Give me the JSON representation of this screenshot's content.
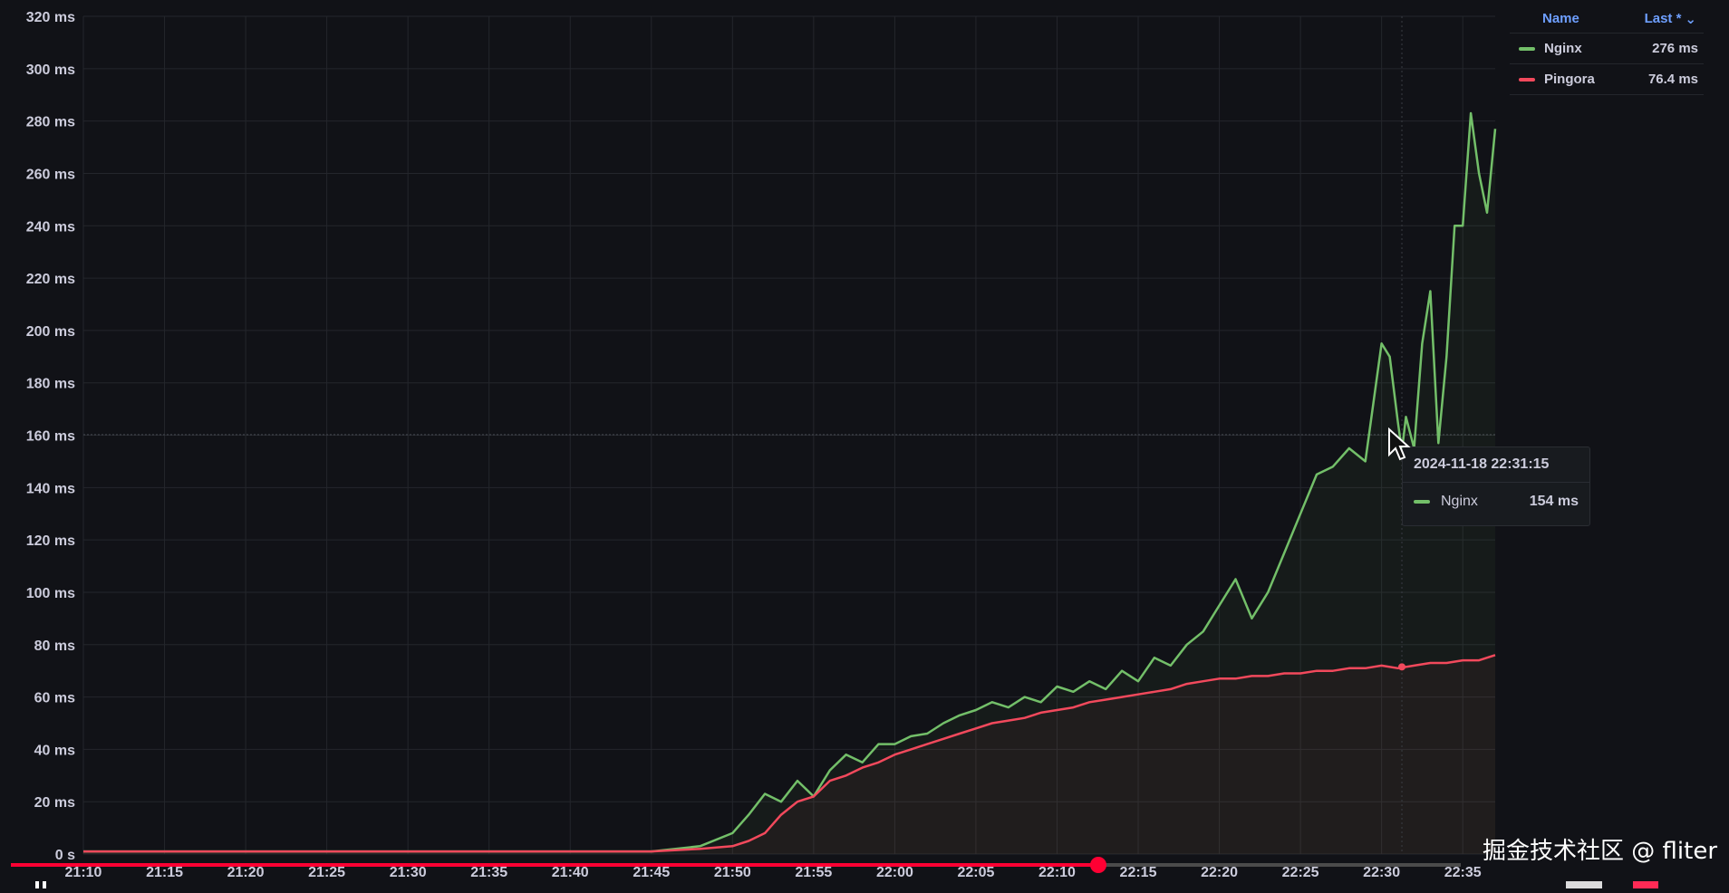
{
  "chart_data": {
    "type": "line",
    "y_ticks": [
      "0 s",
      "20 ms",
      "40 ms",
      "60 ms",
      "80 ms",
      "100 ms",
      "120 ms",
      "140 ms",
      "160 ms",
      "180 ms",
      "200 ms",
      "220 ms",
      "240 ms",
      "260 ms",
      "280 ms",
      "300 ms",
      "320 ms"
    ],
    "x_ticks": [
      "21:10",
      "21:15",
      "21:20",
      "21:25",
      "21:30",
      "21:35",
      "21:40",
      "21:45",
      "21:50",
      "21:55",
      "22:00",
      "22:05",
      "22:10",
      "22:15",
      "22:20",
      "22:25",
      "22:30",
      "22:35"
    ],
    "ylim": [
      0,
      320
    ],
    "x_range": [
      "21:10",
      "22:37"
    ],
    "grid": true,
    "series": [
      {
        "name": "Nginx",
        "color": "#73bf69",
        "x": [
          "21:10",
          "21:45",
          "21:48",
          "21:50",
          "21:51",
          "21:52",
          "21:53",
          "21:54",
          "21:55",
          "21:56",
          "21:57",
          "21:58",
          "21:59",
          "22:00",
          "22:01",
          "22:02",
          "22:03",
          "22:04",
          "22:05",
          "22:06",
          "22:07",
          "22:08",
          "22:09",
          "22:10",
          "22:11",
          "22:12",
          "22:13",
          "22:14",
          "22:15",
          "22:16",
          "22:17",
          "22:18",
          "22:19",
          "22:20",
          "22:21",
          "22:22",
          "22:23",
          "22:24",
          "22:25",
          "22:26",
          "22:27",
          "22:28",
          "22:29",
          "22:30",
          "22:30:30",
          "22:31",
          "22:31:15",
          "22:31:30",
          "22:32",
          "22:32:30",
          "22:33",
          "22:33:30",
          "22:34",
          "22:34:30",
          "22:35",
          "22:35:30",
          "22:36",
          "22:36:30",
          "22:37"
        ],
        "values": [
          1,
          1,
          3,
          8,
          15,
          23,
          20,
          28,
          22,
          32,
          38,
          35,
          42,
          42,
          45,
          46,
          50,
          53,
          55,
          58,
          56,
          60,
          58,
          64,
          62,
          66,
          63,
          70,
          66,
          75,
          72,
          80,
          85,
          95,
          105,
          90,
          100,
          115,
          130,
          145,
          148,
          155,
          150,
          195,
          190,
          165,
          154,
          167,
          155,
          195,
          215,
          157,
          190,
          240,
          240,
          283,
          260,
          245,
          277
        ],
        "last": "276 ms"
      },
      {
        "name": "Pingora",
        "color": "#f2495c",
        "x": [
          "21:10",
          "21:45",
          "21:48",
          "21:50",
          "21:51",
          "21:52",
          "21:53",
          "21:54",
          "21:55",
          "21:56",
          "21:57",
          "21:58",
          "21:59",
          "22:00",
          "22:01",
          "22:02",
          "22:03",
          "22:04",
          "22:05",
          "22:06",
          "22:07",
          "22:08",
          "22:09",
          "22:10",
          "22:11",
          "22:12",
          "22:13",
          "22:14",
          "22:15",
          "22:16",
          "22:17",
          "22:18",
          "22:19",
          "22:20",
          "22:21",
          "22:22",
          "22:23",
          "22:24",
          "22:25",
          "22:26",
          "22:27",
          "22:28",
          "22:29",
          "22:30",
          "22:31",
          "22:32",
          "22:33",
          "22:34",
          "22:35",
          "22:36",
          "22:37"
        ],
        "values": [
          1,
          1,
          2,
          3,
          5,
          8,
          15,
          20,
          22,
          28,
          30,
          33,
          35,
          38,
          40,
          42,
          44,
          46,
          48,
          50,
          51,
          52,
          54,
          55,
          56,
          58,
          59,
          60,
          61,
          62,
          63,
          65,
          66,
          67,
          67,
          68,
          68,
          69,
          69,
          70,
          70,
          71,
          71,
          72,
          71,
          72,
          73,
          73,
          74,
          74,
          76
        ],
        "last": "76.4 ms"
      }
    ]
  },
  "legend": {
    "name_header": "Name",
    "last_header": "Last *",
    "items": [
      {
        "name": "Nginx",
        "value": "276 ms",
        "color": "#73bf69"
      },
      {
        "name": "Pingora",
        "value": "76.4 ms",
        "color": "#f2495c"
      }
    ]
  },
  "tooltip": {
    "time": "2024-11-18 22:31:15",
    "series": "Nginx",
    "value": "154 ms"
  },
  "video": {
    "progress": 0.75,
    "watermark": "掘金技术社区 @ fliter"
  }
}
